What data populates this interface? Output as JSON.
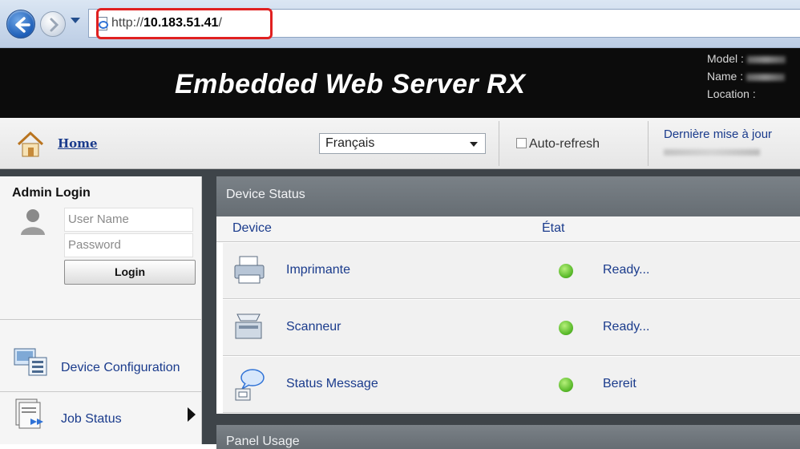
{
  "browser": {
    "url_prefix": "http://",
    "url_host": "10.183.51.41",
    "url_suffix": "/"
  },
  "header": {
    "title": "Embedded Web Server RX",
    "model_label": "Model :",
    "name_label": "Name :",
    "location_label": "Location :"
  },
  "toolbar": {
    "home_label": "Home",
    "language_selected": "Français",
    "auto_refresh_label": "Auto-refresh",
    "last_update_label": "Dernière mise à jour"
  },
  "sidebar": {
    "admin_title": "Admin Login",
    "username_placeholder": "User Name",
    "password_placeholder": "Password",
    "login_button": "Login",
    "items": [
      {
        "label": "Device Configuration",
        "icon": "device-configuration-icon"
      },
      {
        "label": "Job Status",
        "icon": "job-status-icon"
      }
    ]
  },
  "device_status": {
    "title": "Device Status",
    "col_device": "Device",
    "col_state": "État",
    "rows": [
      {
        "device": "Imprimante",
        "state": "Ready...",
        "icon": "printer-icon"
      },
      {
        "device": "Scanneur",
        "state": "Ready...",
        "icon": "scanner-icon"
      },
      {
        "device": "Status Message",
        "state": "Bereit",
        "icon": "status-message-icon"
      }
    ]
  },
  "next_panel": {
    "title": "Panel Usage"
  },
  "colors": {
    "banner": "#0c0c0c",
    "link": "#1a3b8c",
    "status_ok": "#59b92a",
    "url_highlight": "#e02020"
  }
}
